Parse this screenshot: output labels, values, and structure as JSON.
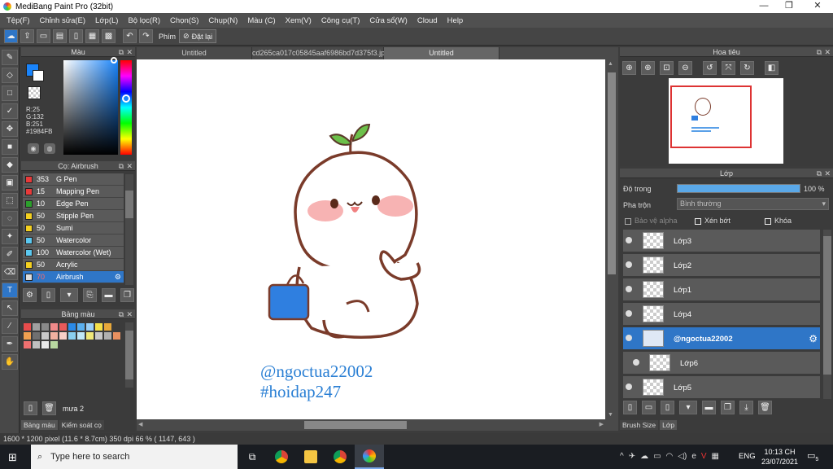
{
  "window": {
    "title": "MediBang Paint Pro (32bit)",
    "min": "—",
    "max": "❐",
    "close": "✕"
  },
  "menu": [
    "Tệp(F)",
    "Chỉnh sửa(E)",
    "Lớp(L)",
    "Bộ lọc(R)",
    "Chọn(S)",
    "Chụp(N)",
    "Màu (C)",
    "Xem(V)",
    "Công cụ(T)",
    "Cửa sổ(W)",
    "Cloud",
    "Help"
  ],
  "toolbar": {
    "key_label": "Phím",
    "reset_label": "Đặt lại"
  },
  "color_panel": {
    "title": "Màu",
    "r": "R:25",
    "g": "G:132",
    "b": "B:251",
    "hex": "#1984FB",
    "fg_color": "#1984FB",
    "bg_color": "#ffffff"
  },
  "brush_panel": {
    "title": "Cọ: Airbrush",
    "items": [
      {
        "size": "353",
        "name": "G Pen",
        "color": "#e83a3a"
      },
      {
        "size": "15",
        "name": "Mapping Pen",
        "color": "#e83a3a"
      },
      {
        "size": "10",
        "name": "Edge Pen",
        "color": "#2ca02c"
      },
      {
        "size": "50",
        "name": "Stipple Pen",
        "color": "#f4d020"
      },
      {
        "size": "50",
        "name": "Sumi",
        "color": "#f4d020"
      },
      {
        "size": "50",
        "name": "Watercolor",
        "color": "#5bc8f0"
      },
      {
        "size": "100",
        "name": "Watercolor (Wet)",
        "color": "#5bc8f0"
      },
      {
        "size": "50",
        "name": "Acrylic",
        "color": "#f4d020"
      },
      {
        "size": "70",
        "name": "Airbrush",
        "color": "#dddddd"
      }
    ]
  },
  "palette_panel": {
    "title": "Bảng màu",
    "palette_name": "mưa 2",
    "colors": [
      "#e84c4c",
      "#a0a0a0",
      "#8a8a8a",
      "#f08a8a",
      "#e85a5a",
      "#2a8ae8",
      "#5ab0f0",
      "#9ad0f8",
      "#f4e04a",
      "#e8a83a",
      "#3a3a3a",
      "#f0a050",
      "#707070",
      "#c8c8c8",
      "#f0b0a0",
      "#f8d0c8",
      "#8ad0f0",
      "#c0e8f8",
      "#f0e878",
      "#c8c8c8",
      "#b0b0b0",
      "#e89060",
      "#f07070",
      "#c0c0c0",
      "#e8e8e8",
      "#b8d8a0"
    ]
  },
  "tabs": [
    "Untitled",
    "cd265ca017c05845aaf6986bd7d375f3.jpg",
    "Untitled"
  ],
  "canvas": {
    "handle_line": "@ngoctua22002",
    "tag_line": "#hoidap247",
    "text_color": "#2a7fd4"
  },
  "status": {
    "text": "1600 * 1200 pixel   (11.6 * 8.7cm)   350 dpi   66 %   ( 1147, 643 )"
  },
  "navigator": {
    "title": "Hoa tiêu"
  },
  "layer_panel": {
    "title": "Lớp",
    "opacity_label": "Độ trong",
    "opacity_value": "100 %",
    "opacity_fraction": 1.0,
    "blend_label": "Pha trộn",
    "blend_value": "Bình thường",
    "protect_alpha": "Bảo vệ alpha",
    "clip": "Xén bớt",
    "lock": "Khóa",
    "layers": [
      "Lớp3",
      "Lớp2",
      "Lớp1",
      "Lớp4",
      "@ngoctua22002",
      "Lớp6",
      "Lớp5"
    ]
  },
  "bottom_tabs": {
    "left": [
      "Bảng màu",
      "Kiểm soát cọ"
    ],
    "right": [
      "Brush Size",
      "Lớp"
    ]
  },
  "taskbar": {
    "search_placeholder": "Type here to search",
    "lang": "ENG",
    "time": "10:13 CH",
    "date": "23/07/2021",
    "notif": "5"
  }
}
